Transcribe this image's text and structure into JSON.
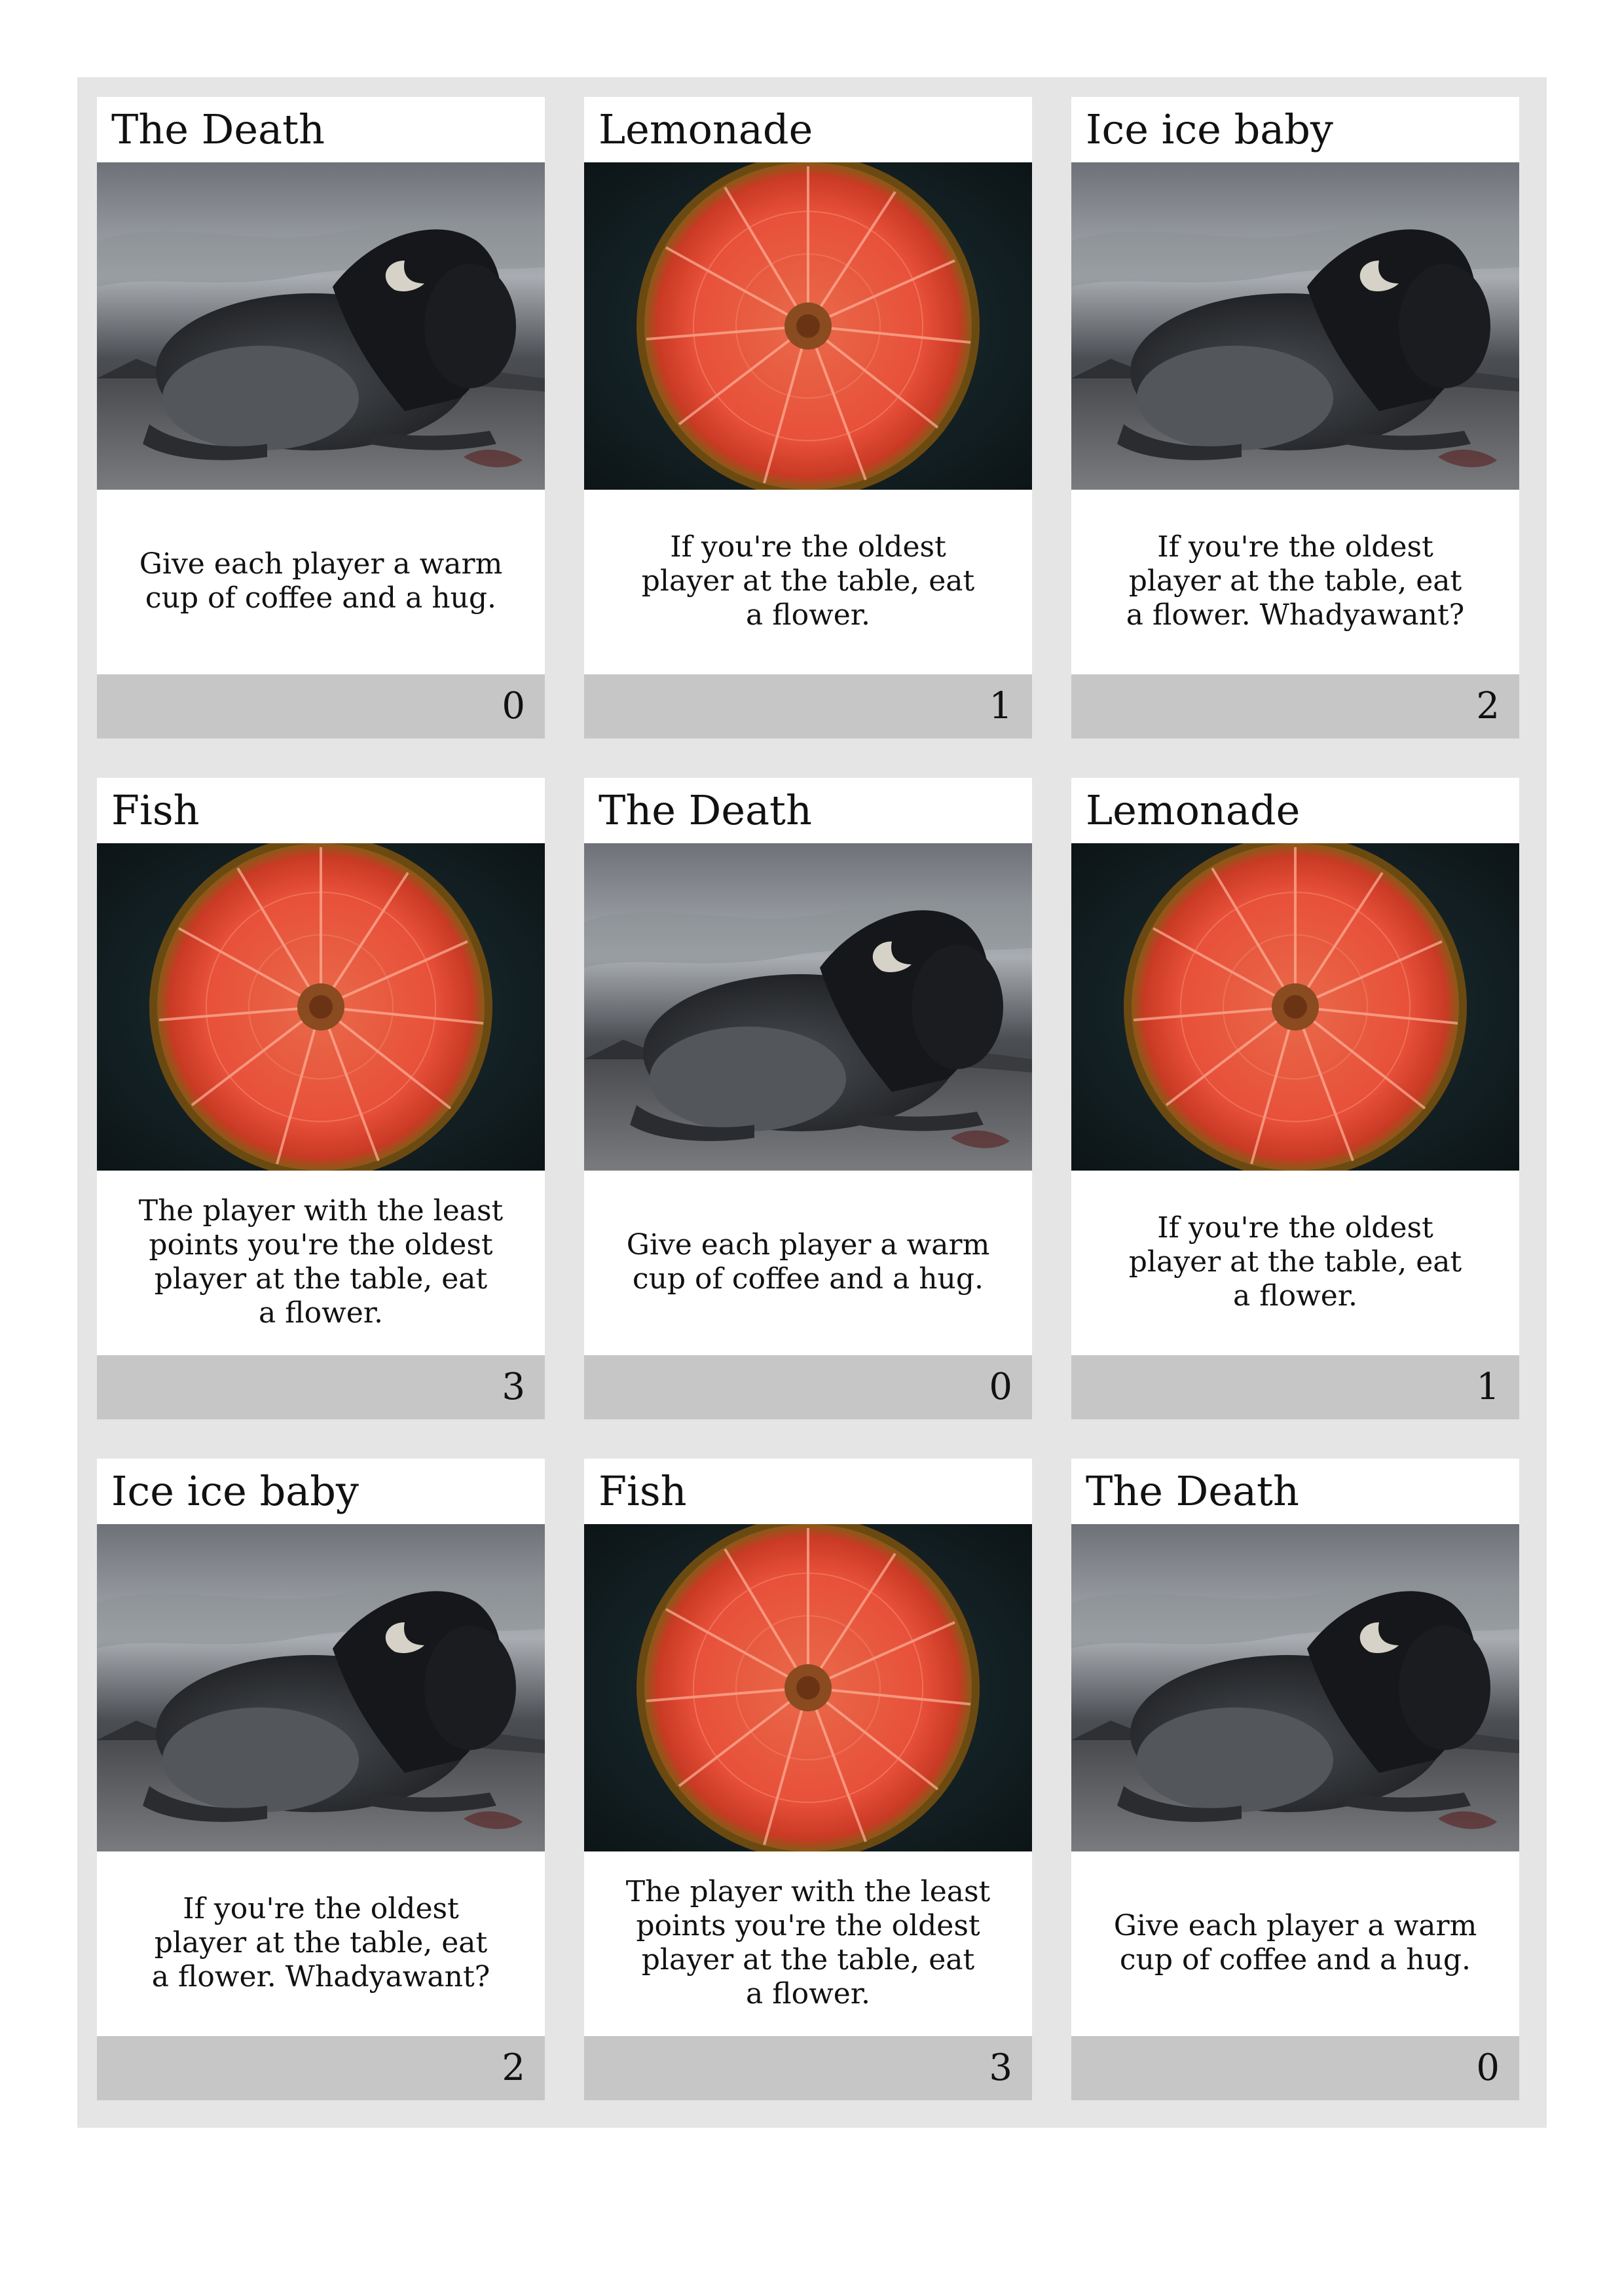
{
  "colors": {
    "sheet_background": "#e5e5e5",
    "card_background": "#ffffff",
    "footer_background": "#c6c6c6",
    "text": "#111111"
  },
  "cards": [
    {
      "title": "The Death",
      "art": "bison-art",
      "text": "Give each player a warm\ncup of coffee and a hug.",
      "value": "0"
    },
    {
      "title": "Lemonade",
      "art": "grapefruit-art",
      "text": "If you're the oldest\nplayer at the table, eat\na flower.",
      "value": "1"
    },
    {
      "title": "Ice ice baby",
      "art": "bison-art",
      "text": "If you're the oldest\nplayer at the table, eat\na flower.  Whadyawant?",
      "value": "2"
    },
    {
      "title": "Fish",
      "art": "grapefruit-art",
      "text": "The player with the least\npoints you're the oldest\nplayer at the table, eat\na flower.",
      "value": "3"
    },
    {
      "title": "The Death",
      "art": "bison-art",
      "text": "Give each player a warm\ncup of coffee and a hug.",
      "value": "0"
    },
    {
      "title": "Lemonade",
      "art": "grapefruit-art",
      "text": "If you're the oldest\nplayer at the table, eat\na flower.",
      "value": "1"
    },
    {
      "title": "Ice ice baby",
      "art": "bison-art",
      "text": "If you're the oldest\nplayer at the table, eat\na flower.  Whadyawant?",
      "value": "2"
    },
    {
      "title": "Fish",
      "art": "grapefruit-art",
      "text": "The player with the least\npoints you're the oldest\nplayer at the table, eat\na flower.",
      "value": "3"
    },
    {
      "title": "The Death",
      "art": "bison-art",
      "text": "Give each player a warm\ncup of coffee and a hug.",
      "value": "0"
    }
  ]
}
